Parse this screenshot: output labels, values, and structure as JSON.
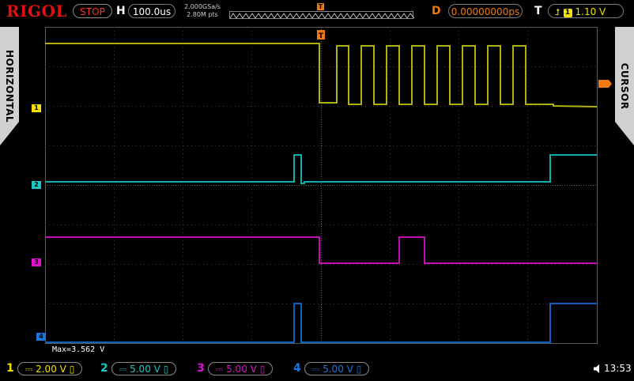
{
  "header": {
    "logo": "RIGOL",
    "run_state": "STOP",
    "h_label": "H",
    "timebase": "100.0us",
    "sample_rate": "2.000GSa/s",
    "memory_depth": "2.80M pts",
    "d_label": "D",
    "delay": "0.00000000ps",
    "t_label": "T",
    "trigger_channel": "1",
    "trigger_level": "1.10 V"
  },
  "side_tabs": {
    "left": "HORIZONTAL",
    "right": "CURSOR"
  },
  "measurement": "Max=3.562 V",
  "channels": [
    {
      "num": "1",
      "scale": "2.00 V",
      "color": "#f5e000"
    },
    {
      "num": "2",
      "scale": "5.00 V",
      "color": "#18c8c8"
    },
    {
      "num": "3",
      "scale": "5.00 V",
      "color": "#e010d0"
    },
    {
      "num": "4",
      "scale": "5.00 V",
      "color": "#1878e0"
    }
  ],
  "clock": "13:53",
  "colors": {
    "ch1_trace": "#b0b010",
    "ch2_trace": "#10b0b0",
    "ch3_trace": "#c010b0",
    "ch4_trace": "#1060c0",
    "trigger_marker": "#f07a10",
    "stop": "#ff3030"
  }
}
